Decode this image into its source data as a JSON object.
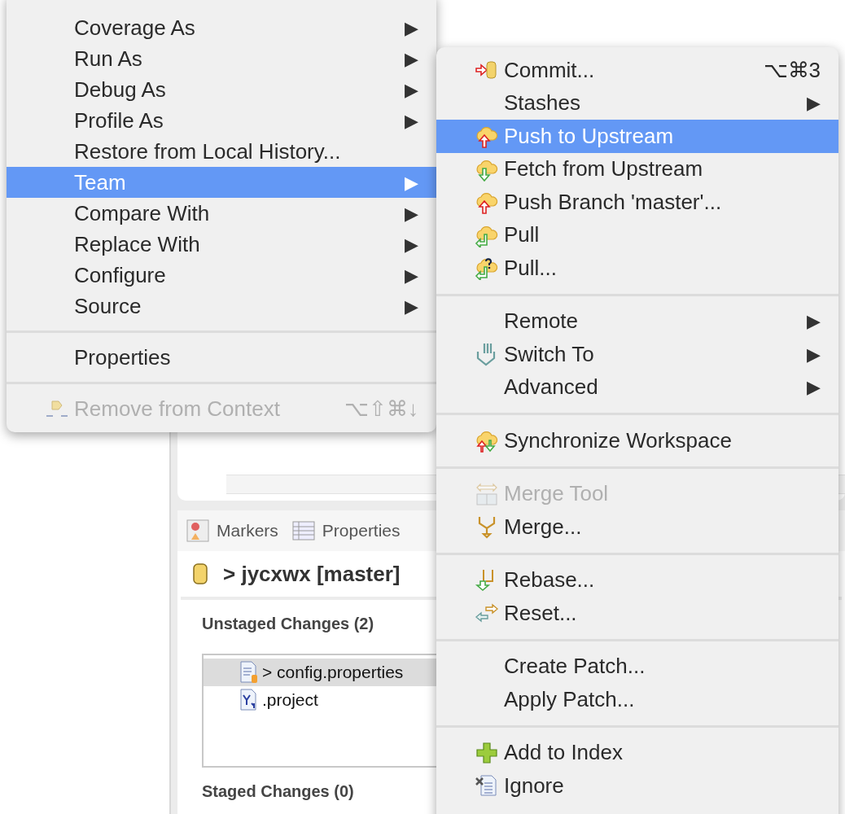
{
  "context_menu": {
    "items": [
      {
        "kind": "submenu",
        "label": "Coverage As",
        "arrow": "▶",
        "selected": false,
        "disabled": false
      },
      {
        "kind": "submenu",
        "label": "Run As",
        "arrow": "▶",
        "selected": false,
        "disabled": false
      },
      {
        "kind": "submenu",
        "label": "Debug As",
        "arrow": "▶",
        "selected": false,
        "disabled": false
      },
      {
        "kind": "submenu",
        "label": "Profile As",
        "arrow": "▶",
        "selected": false,
        "disabled": false
      },
      {
        "kind": "action",
        "label": "Restore from Local History...",
        "selected": false,
        "disabled": false
      },
      {
        "kind": "submenu",
        "label": "Team",
        "arrow": "▶",
        "selected": true,
        "disabled": false
      },
      {
        "kind": "submenu",
        "label": "Compare With",
        "arrow": "▶",
        "selected": false,
        "disabled": false
      },
      {
        "kind": "submenu",
        "label": "Replace With",
        "arrow": "▶",
        "selected": false,
        "disabled": false
      },
      {
        "kind": "submenu",
        "label": "Configure",
        "arrow": "▶",
        "selected": false,
        "disabled": false
      },
      {
        "kind": "submenu",
        "label": "Source",
        "arrow": "▶",
        "selected": false,
        "disabled": false
      },
      {
        "kind": "separator"
      },
      {
        "kind": "action",
        "label": "Properties",
        "selected": false,
        "disabled": false
      },
      {
        "kind": "separator"
      },
      {
        "kind": "action",
        "label": "Remove from Context",
        "shortcut": "⌥⇧⌘↓",
        "selected": false,
        "disabled": true
      }
    ]
  },
  "team_menu": {
    "items": [
      {
        "kind": "action",
        "label": "Commit...",
        "shortcut": "⌥⌘3",
        "selected": false,
        "disabled": false
      },
      {
        "kind": "submenu",
        "label": "Stashes",
        "arrow": "▶",
        "selected": false,
        "disabled": false
      },
      {
        "kind": "action",
        "label": "Push to Upstream",
        "selected": true,
        "disabled": false
      },
      {
        "kind": "action",
        "label": "Fetch from Upstream",
        "selected": false,
        "disabled": false
      },
      {
        "kind": "action",
        "label": "Push Branch 'master'...",
        "selected": false,
        "disabled": false
      },
      {
        "kind": "action",
        "label": "Pull",
        "selected": false,
        "disabled": false
      },
      {
        "kind": "action",
        "label": "Pull...",
        "selected": false,
        "disabled": false
      },
      {
        "kind": "separator"
      },
      {
        "kind": "submenu",
        "label": "Remote",
        "arrow": "▶",
        "selected": false,
        "disabled": false
      },
      {
        "kind": "submenu",
        "label": "Switch To",
        "arrow": "▶",
        "selected": false,
        "disabled": false
      },
      {
        "kind": "submenu",
        "label": "Advanced",
        "arrow": "▶",
        "selected": false,
        "disabled": false
      },
      {
        "kind": "separator"
      },
      {
        "kind": "action",
        "label": "Synchronize Workspace",
        "selected": false,
        "disabled": false
      },
      {
        "kind": "separator"
      },
      {
        "kind": "action",
        "label": "Merge Tool",
        "selected": false,
        "disabled": true
      },
      {
        "kind": "action",
        "label": "Merge...",
        "selected": false,
        "disabled": false
      },
      {
        "kind": "separator"
      },
      {
        "kind": "action",
        "label": "Rebase...",
        "selected": false,
        "disabled": false
      },
      {
        "kind": "action",
        "label": "Reset...",
        "selected": false,
        "disabled": false
      },
      {
        "kind": "separator"
      },
      {
        "kind": "action",
        "label": "Create Patch...",
        "selected": false,
        "disabled": false
      },
      {
        "kind": "action",
        "label": "Apply Patch...",
        "selected": false,
        "disabled": false
      },
      {
        "kind": "separator"
      },
      {
        "kind": "action",
        "label": "Add to Index",
        "selected": false,
        "disabled": false
      },
      {
        "kind": "action",
        "label": "Ignore",
        "selected": false,
        "disabled": false
      }
    ]
  },
  "bottom_panel": {
    "tabs": [
      {
        "label": "Markers"
      },
      {
        "label": "Properties"
      }
    ],
    "repository": "> jycxwx [master]",
    "unstaged": {
      "title": "Unstaged Changes (2)",
      "files": [
        {
          "name": "> config.properties",
          "selected": true
        },
        {
          "name": ".project",
          "selected": false
        }
      ]
    },
    "staged": {
      "title": "Staged Changes (0)"
    }
  }
}
